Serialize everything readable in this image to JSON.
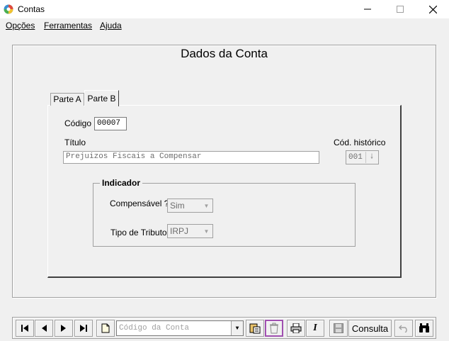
{
  "window": {
    "title": "Contas",
    "minimize_icon": "minimize-icon",
    "maximize_icon": "maximize-icon",
    "close_icon": "close-icon"
  },
  "menu": {
    "items": [
      {
        "label": "Opções"
      },
      {
        "label": "Ferramentas"
      },
      {
        "label": "Ajuda"
      }
    ]
  },
  "form": {
    "title": "Dados da Conta",
    "tabs": [
      {
        "label": "Parte A",
        "selected": false
      },
      {
        "label": "Parte B",
        "selected": true
      }
    ],
    "codigo_label": "Código",
    "codigo_value": "00007",
    "titulo_label": "Título",
    "titulo_value": "Prejuizos Fiscais a Compensar",
    "cod_historico_label": "Cód. histórico",
    "cod_historico_value": "001",
    "indicador": {
      "legend": "Indicador",
      "compensavel_label": "Compensável ?",
      "compensavel_value": "Sim",
      "tipo_tributo_label": "Tipo de Tributo",
      "tipo_tributo_value": "IRPJ"
    }
  },
  "toolbar": {
    "search_placeholder": "Código da Conta",
    "consulta_label": "Consulta",
    "italic_label": "I",
    "icons": [
      "first-record-icon",
      "previous-record-icon",
      "next-record-icon",
      "last-record-icon",
      "new-document-icon",
      "paste-document-icon",
      "delete-icon",
      "print-icon",
      "italic-icon",
      "save-icon",
      "undo-icon",
      "binoculars-icon"
    ],
    "highlight_color": "#a050b0"
  }
}
